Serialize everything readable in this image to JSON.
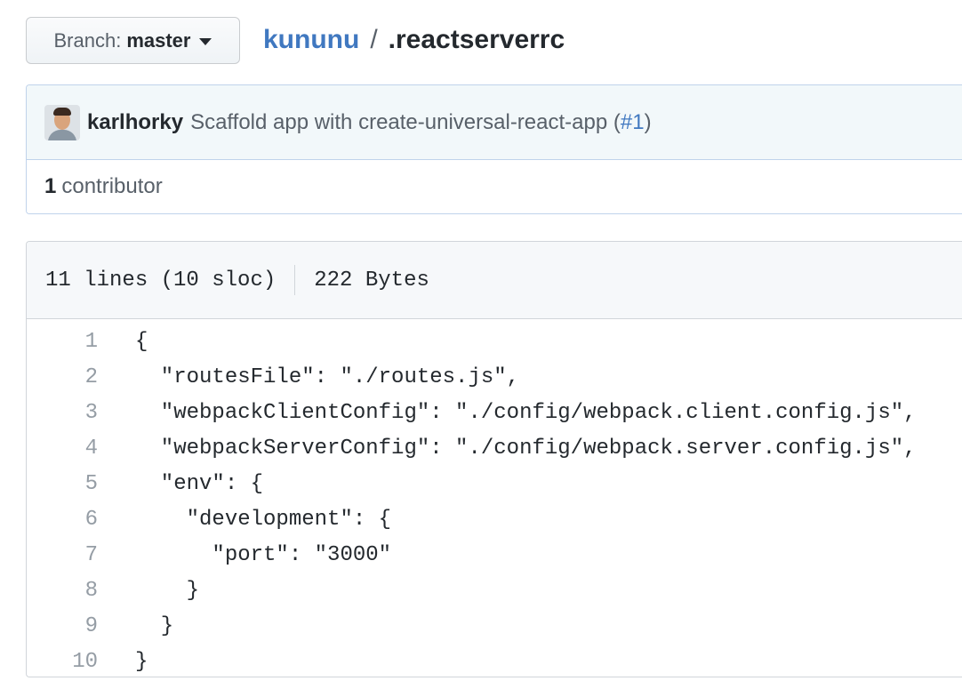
{
  "branch": {
    "label": "Branch:",
    "value": "master"
  },
  "breadcrumb": {
    "repo": "kununu",
    "separator": "/",
    "file": ".reactserverrc"
  },
  "commit": {
    "author": "karlhorky",
    "message_prefix": "Scaffold app with create-universal-react-app (",
    "pr_link": "#1",
    "message_suffix": ")"
  },
  "contributors": {
    "count": "1",
    "label": "contributor"
  },
  "file_info": {
    "lines": "11 lines (10 sloc)",
    "size": "222 Bytes"
  },
  "code_lines": [
    {
      "num": "1",
      "text": "{"
    },
    {
      "num": "2",
      "text": "  \"routesFile\": \"./routes.js\","
    },
    {
      "num": "3",
      "text": "  \"webpackClientConfig\": \"./config/webpack.client.config.js\","
    },
    {
      "num": "4",
      "text": "  \"webpackServerConfig\": \"./config/webpack.server.config.js\","
    },
    {
      "num": "5",
      "text": "  \"env\": {"
    },
    {
      "num": "6",
      "text": "    \"development\": {"
    },
    {
      "num": "7",
      "text": "      \"port\": \"3000\""
    },
    {
      "num": "8",
      "text": "    }"
    },
    {
      "num": "9",
      "text": "  }"
    },
    {
      "num": "10",
      "text": "}"
    }
  ],
  "colors": {
    "link": "#4078c0",
    "commit_bg": "#f2f8fa",
    "header_bg": "#f6f8fa"
  }
}
